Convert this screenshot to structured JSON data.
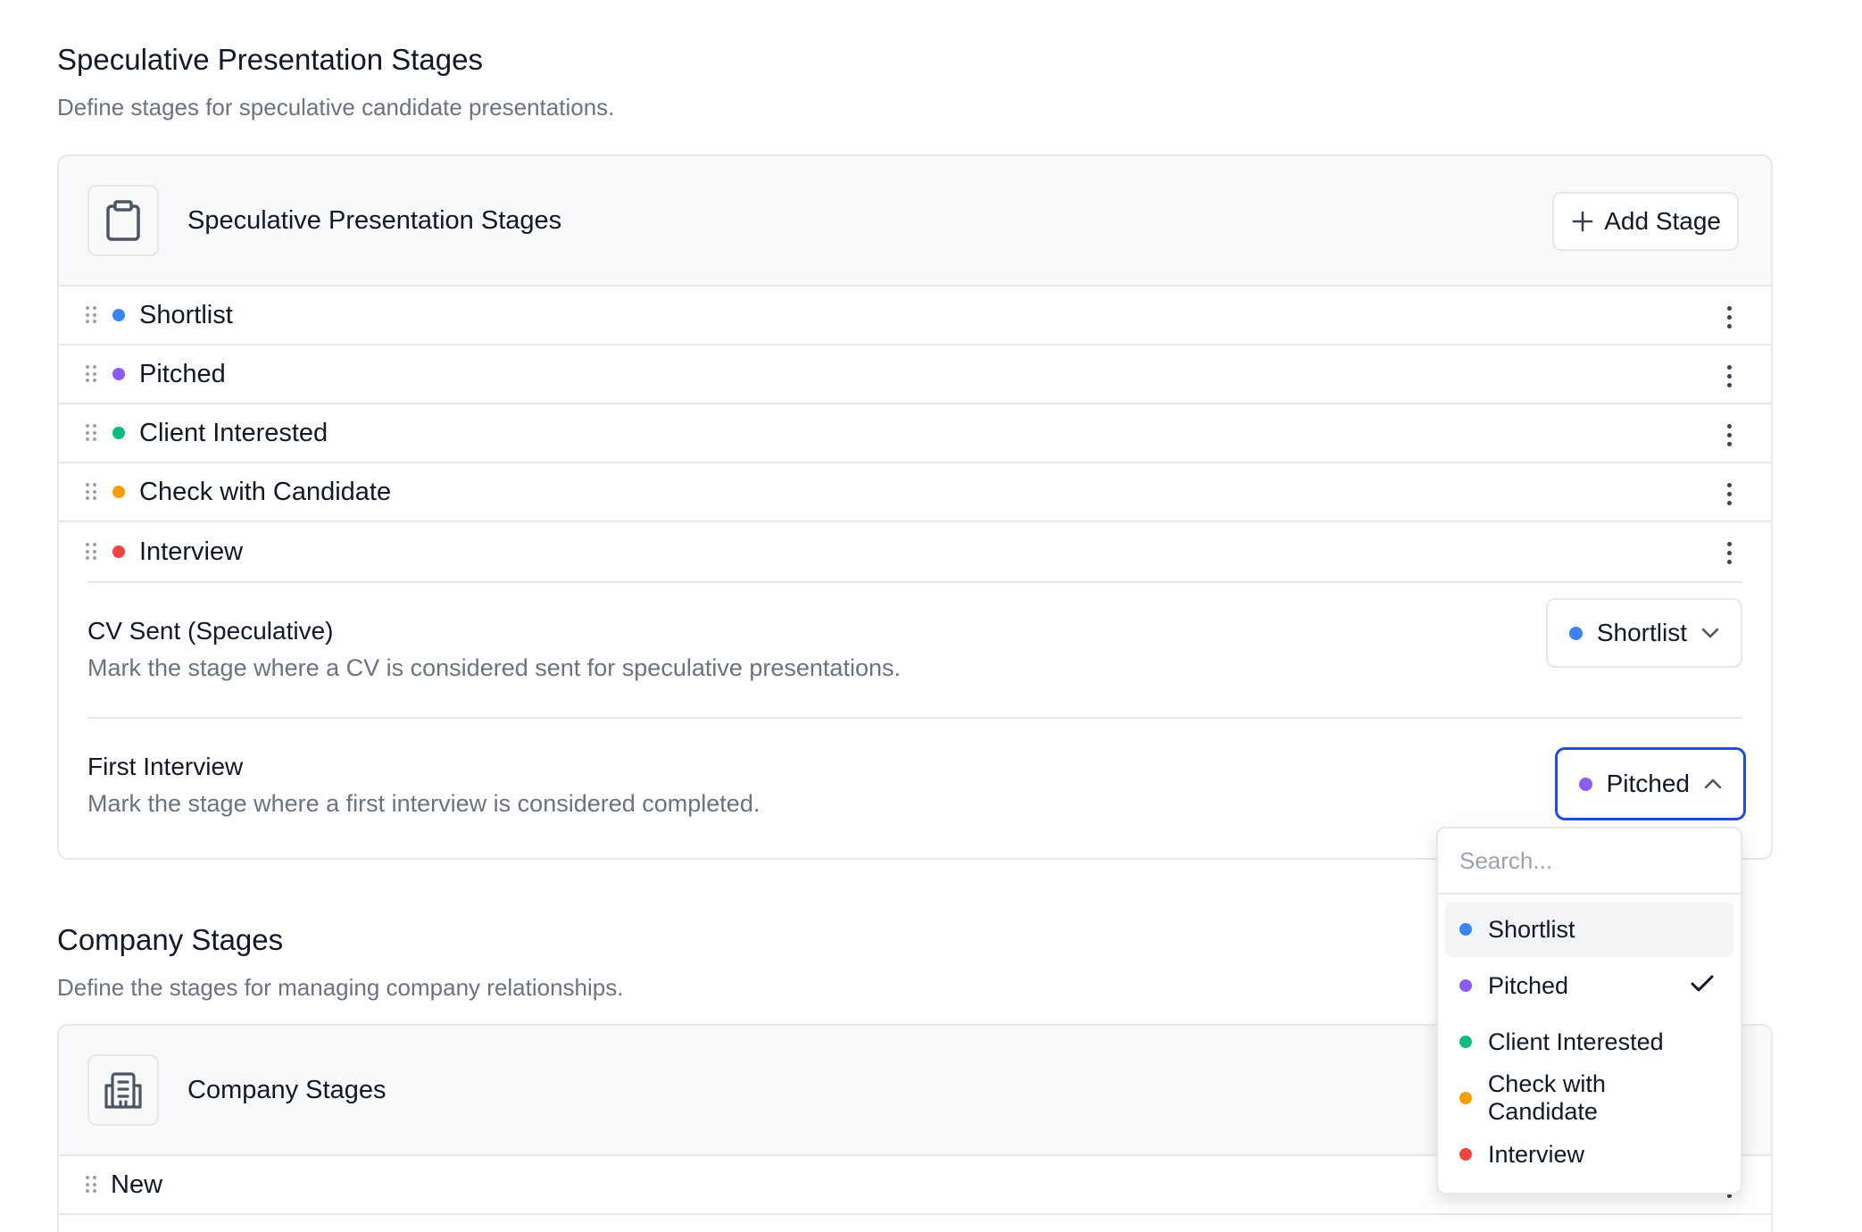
{
  "speculative": {
    "section_title": "Speculative Presentation Stages",
    "section_desc": "Define stages for speculative candidate presentations.",
    "card_title": "Speculative Presentation Stages",
    "card_icon": "clipboard-icon",
    "add_button": "Add Stage",
    "stages": [
      {
        "label": "Shortlist",
        "color": "#3b82f6"
      },
      {
        "label": "Pitched",
        "color": "#8b5cf6"
      },
      {
        "label": "Client Interested",
        "color": "#10b981"
      },
      {
        "label": "Check with Candidate",
        "color": "#f59e0b"
      },
      {
        "label": "Interview",
        "color": "#ef4444"
      }
    ],
    "cv_sent": {
      "title": "CV Sent (Speculative)",
      "desc": "Mark the stage where a CV is considered sent for speculative presentations.",
      "value": "Shortlist",
      "color": "#3b82f6"
    },
    "first_interview": {
      "title": "First Interview",
      "desc": "Mark the stage where a first interview is considered completed.",
      "value": "Pitched",
      "color": "#8b5cf6"
    }
  },
  "dropdown": {
    "search_placeholder": "Search...",
    "options": [
      {
        "label": "Shortlist",
        "color": "#3b82f6",
        "highlighted": true,
        "selected": false
      },
      {
        "label": "Pitched",
        "color": "#8b5cf6",
        "highlighted": false,
        "selected": true
      },
      {
        "label": "Client Interested",
        "color": "#10b981",
        "highlighted": false,
        "selected": false
      },
      {
        "label": "Check with Candidate",
        "color": "#f59e0b",
        "highlighted": false,
        "selected": false
      },
      {
        "label": "Interview",
        "color": "#ef4444",
        "highlighted": false,
        "selected": false
      }
    ]
  },
  "company": {
    "section_title": "Company Stages",
    "section_desc": "Define the stages for managing company relationships.",
    "card_title": "Company Stages",
    "card_icon": "building-icon",
    "stages": [
      {
        "label": "New"
      }
    ]
  },
  "colors": {
    "accent_border": "#1d4ed8"
  }
}
